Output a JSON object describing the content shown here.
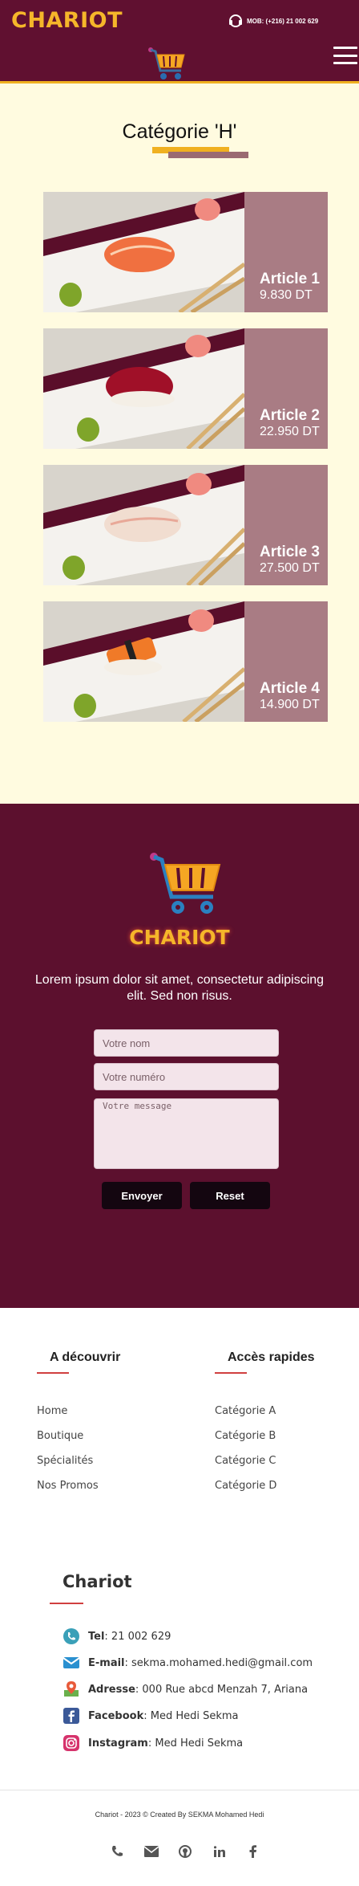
{
  "header": {
    "brand": "CHARIOT",
    "phone": "MOB: (+216) 21 002 629",
    "cart_icon": "cart-icon",
    "menu_icon": "hamburger-menu-icon",
    "accent": "#f0b020",
    "background": "#601030"
  },
  "category": {
    "title": "Catégorie 'H'"
  },
  "articles": [
    {
      "name": "Article 1",
      "price": "9.830 DT"
    },
    {
      "name": "Article 2",
      "price": "22.950 DT"
    },
    {
      "name": "Article 3",
      "price": "27.500 DT"
    },
    {
      "name": "Article 4",
      "price": "14.900 DT"
    }
  ],
  "contact": {
    "brand": "CHARIOT",
    "lorem": "Lorem ipsum dolor sit amet, consectetur adipiscing elit. Sed non risus.",
    "name_placeholder": "Votre nom",
    "number_placeholder": "Votre numéro",
    "message_placeholder": "Votre message",
    "send_label": "Envoyer",
    "reset_label": "Reset"
  },
  "links": {
    "discover": {
      "title": "A découvrir",
      "items": [
        "Home",
        "Boutique",
        "Spécialités",
        "Nos Promos"
      ]
    },
    "quick": {
      "title": "Accès rapides",
      "items": [
        "Catégorie A",
        "Catégorie B",
        "Catégorie C",
        "Catégorie D"
      ]
    }
  },
  "info": {
    "title": "Chariot",
    "tel_label": "Tel",
    "tel": ": 21 002 629",
    "email_label": "E-mail",
    "email": ": sekma.mohamed.hedi@gmail.com",
    "address_label": "Adresse",
    "address": ": 000 Rue abcd Menzah 7, Ariana",
    "facebook_label": "Facebook",
    "facebook": ": Med Hedi Sekma",
    "instagram_label": "Instagram",
    "instagram": ": Med Hedi Sekma"
  },
  "footer": {
    "copyright": "Chariot - 2023 © Created By SEKMA Mohamed Hedi",
    "socials": [
      "phone-icon",
      "mail-icon",
      "github-icon",
      "linkedin-icon",
      "facebook-icon"
    ]
  }
}
